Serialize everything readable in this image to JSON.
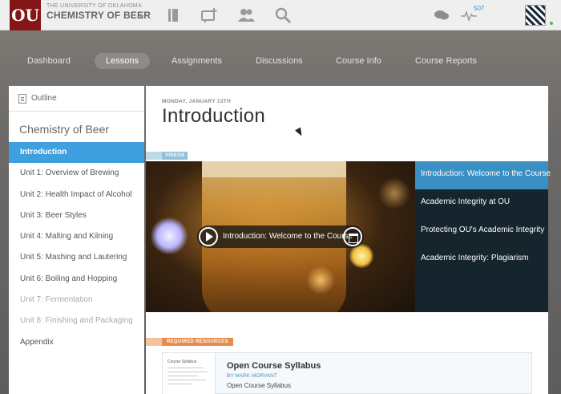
{
  "header": {
    "logo_text": "OU",
    "org": "THE UNIVERSITY OF OKLAHOMA",
    "course": "CHEMISTRY OF BEER",
    "notification_count": "507"
  },
  "nav": [
    {
      "label": "Dashboard"
    },
    {
      "label": "Lessons"
    },
    {
      "label": "Assignments"
    },
    {
      "label": "Discussions"
    },
    {
      "label": "Course Info"
    },
    {
      "label": "Course Reports"
    }
  ],
  "sidebar": {
    "outline_label": "Outline",
    "title": "Chemistry of Beer",
    "items": [
      {
        "label": "Introduction"
      },
      {
        "label": "Unit 1: Overview of Brewing"
      },
      {
        "label": "Unit 2: Health Impact of Alcohol"
      },
      {
        "label": "Unit 3: Beer Styles"
      },
      {
        "label": "Unit 4: Malting and Kilning"
      },
      {
        "label": "Unit 5: Mashing and Lautering"
      },
      {
        "label": "Unit 6: Boiling and Hopping"
      },
      {
        "label": "Unit 7: Fermentation"
      },
      {
        "label": "Unit 8: Finishing and Packaging"
      },
      {
        "label": "Appendix"
      }
    ]
  },
  "main": {
    "date": "MONDAY, JANUARY 13TH",
    "title": "Introduction",
    "videos_tag": "VIDEOS",
    "video_title": "Introduction: Welcome to the Course",
    "playlist": [
      {
        "label": "Introduction: Welcome to the Course"
      },
      {
        "label": "Academic Integrity at OU"
      },
      {
        "label": "Protecting OU's Academic Integrity"
      },
      {
        "label": "Academic Integrity: Plagiarism"
      }
    ],
    "resources_tag": "REQUIRED RESOURCES",
    "resource": {
      "thumb_title": "Course Syllabus",
      "title": "Open Course Syllabus",
      "author": "BY MARK MORVANT",
      "subtitle": "Open Course Syllabus"
    }
  },
  "colors": {
    "brand": "#841617",
    "accent": "#3fa0df",
    "playlist_bg": "#15242d",
    "resources_tag": "#e78b4f"
  }
}
